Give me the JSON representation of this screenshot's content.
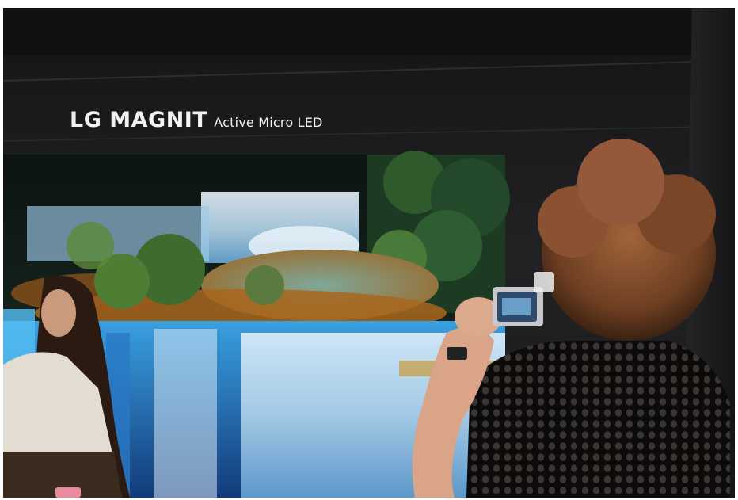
{
  "signage": {
    "brand_name": "LG MAGNIT",
    "product_line": "Active Micro LED"
  },
  "scene": {
    "wall_color": "#1c1c1e",
    "screen_content": "waterfall",
    "accent_water_color": "#3aa0e0"
  }
}
